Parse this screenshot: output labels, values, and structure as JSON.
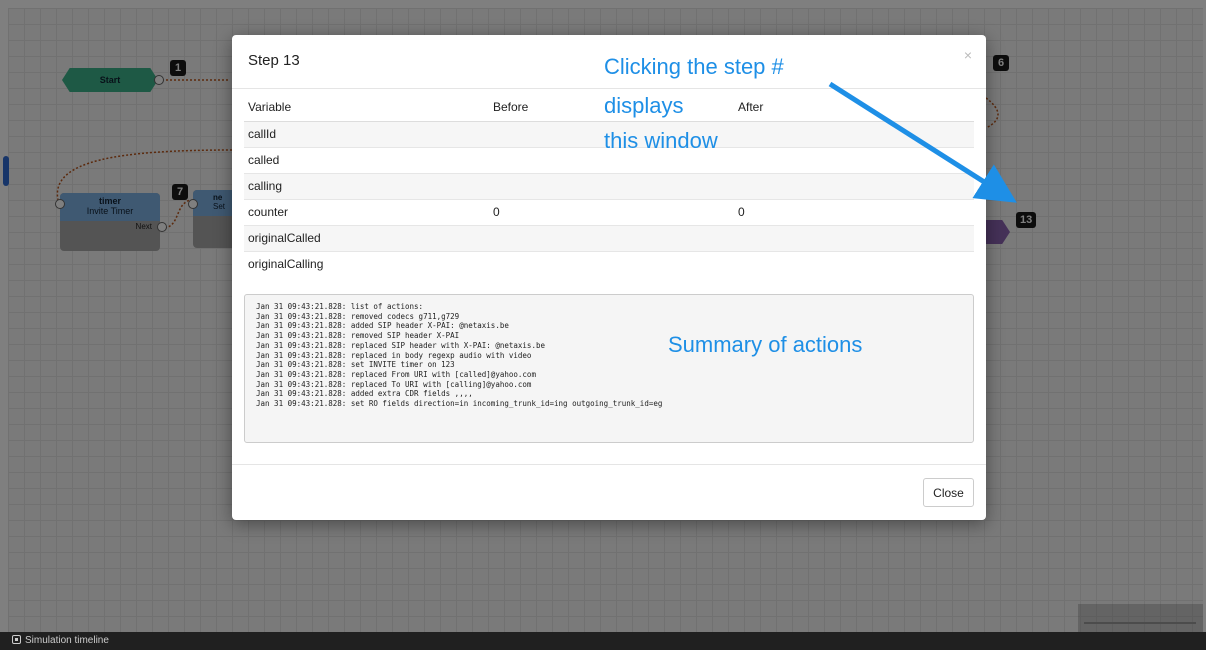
{
  "workflow": {
    "start_label": "Start",
    "timer_title": "timer",
    "timer_subtitle": "Invite Timer",
    "timer_next": "Next",
    "next_title": "ne",
    "next_subtitle": "Set",
    "badges": {
      "b1": "1",
      "b6": "6",
      "b7": "7",
      "b13": "13"
    }
  },
  "modal": {
    "title": "Step 13",
    "close_x": "×",
    "columns": [
      "Variable",
      "Before",
      "After"
    ],
    "rows": [
      {
        "variable": "callId",
        "before": "",
        "after": ""
      },
      {
        "variable": "called",
        "before": "",
        "after": ""
      },
      {
        "variable": "calling",
        "before": "",
        "after": ""
      },
      {
        "variable": "counter",
        "before": "0",
        "after": "0"
      },
      {
        "variable": "originalCalled",
        "before": "",
        "after": ""
      },
      {
        "variable": "originalCalling",
        "before": "",
        "after": ""
      }
    ],
    "log_lines": [
      "Jan 31 09:43:21.828: list of actions:",
      "Jan 31 09:43:21.828: removed codecs g711,g729",
      "Jan 31 09:43:21.828: added SIP header X-PAI: @netaxis.be",
      "Jan 31 09:43:21.828: removed SIP header X-PAI",
      "Jan 31 09:43:21.828: replaced SIP header with X-PAI: @netaxis.be",
      "Jan 31 09:43:21.828: replaced in body regexp audio with video",
      "Jan 31 09:43:21.828: set INVITE timer on 123",
      "Jan 31 09:43:21.828: replaced From URI with [called]@yahoo.com",
      "Jan 31 09:43:21.828: replaced To URI with [calling]@yahoo.com",
      "Jan 31 09:43:21.828: added extra CDR fields ,,,,",
      "Jan 31 09:43:21.828: set RO fields direction=in incoming_trunk_id=ing outgoing_trunk_id=eg"
    ],
    "close_button": "Close"
  },
  "annotations": {
    "line1": "Clicking the step #",
    "line2": "displays",
    "line3": "this window",
    "summary": "Summary of actions",
    "color": "#1e8fe6"
  },
  "footer": {
    "label": "Simulation timeline"
  }
}
